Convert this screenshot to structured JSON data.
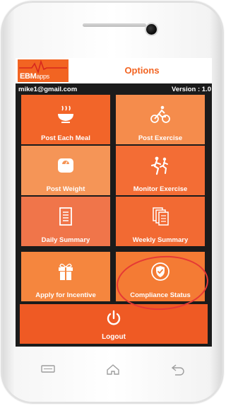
{
  "app": {
    "title": "Options",
    "logo": {
      "brand": "EBM",
      "suffix": "apps"
    }
  },
  "user": {
    "email": "mike1@gmail.com",
    "version": "Version : 1.0"
  },
  "tiles": [
    {
      "label": "Post Each Meal",
      "icon": "meal-bowl-icon",
      "color": "#f26529"
    },
    {
      "label": "Post Exercise",
      "icon": "cyclist-icon",
      "color": "#f58c4c"
    },
    {
      "label": "Post Weight",
      "icon": "scale-icon",
      "color": "#f59557"
    },
    {
      "label": "Monitor Exercise",
      "icon": "runners-icon",
      "color": "#f36d35"
    },
    {
      "label": "Daily Summary",
      "icon": "document-icon",
      "color": "#f0754a"
    },
    {
      "label": "Weekly Summary",
      "icon": "documents-icon",
      "color": "#f26a33"
    },
    {
      "label": "Apply for Incentive",
      "icon": "gift-icon",
      "color": "#f5863e"
    },
    {
      "label": "Compliance Status",
      "icon": "shield-check-icon",
      "color": "#f47b34"
    }
  ],
  "logout": {
    "label": "Logout",
    "icon": "power-icon"
  },
  "highlight_color": "#e53935",
  "accent_color": "#f26422"
}
